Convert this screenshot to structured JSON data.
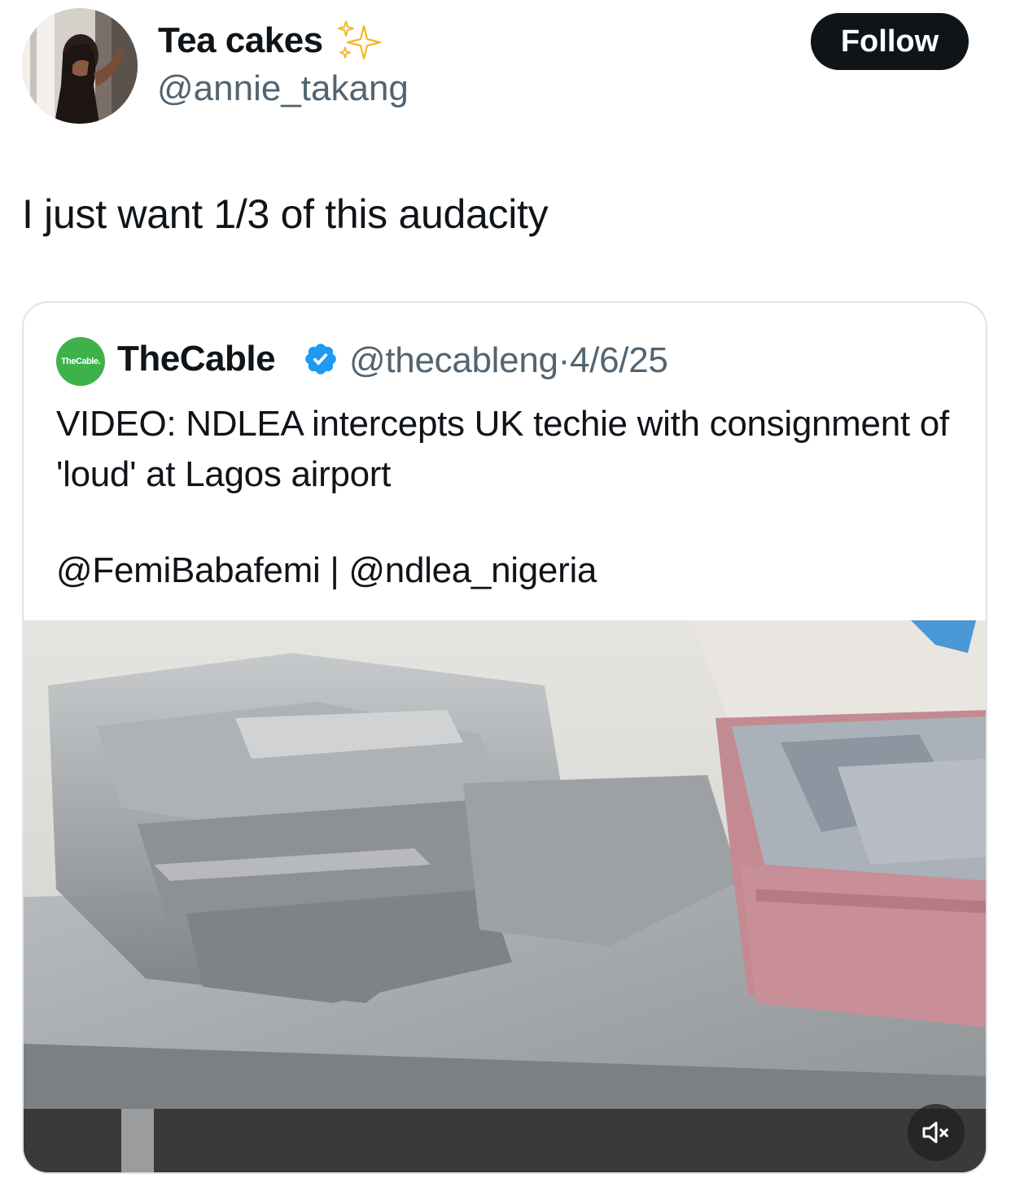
{
  "author": {
    "display_name": "Tea cakes",
    "handle": "@annie_takang",
    "name_emoji": "sparkles-icon"
  },
  "follow_button": {
    "label": "Follow"
  },
  "tweet": {
    "text": "I just want 1/3 of this audacity"
  },
  "quoted_tweet": {
    "avatar_text": "TheCable.",
    "display_name": "TheCable",
    "verified": true,
    "handle": "@thecableng",
    "separator": "·",
    "date": "4/6/25",
    "body": "VIDEO: NDLEA intercepts UK techie with consignment of 'loud' at Lagos airport",
    "mentions": "@FemiBabafemi | @ndlea_nigeria",
    "media": {
      "type": "video",
      "muted": true,
      "mute_icon": "speaker-muted-icon"
    }
  },
  "colors": {
    "text_primary": "#0f1419",
    "text_secondary": "#536471",
    "follow_bg": "#0f1419",
    "verified_blue": "#1d9bf0",
    "border": "#dfe4e8",
    "thecable_green": "#3eb24a"
  }
}
